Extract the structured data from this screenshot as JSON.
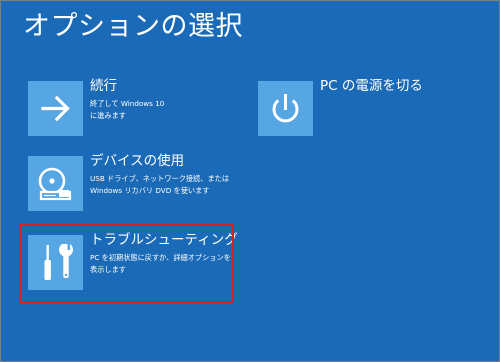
{
  "title": "オプションの選択",
  "options": {
    "continue": {
      "title": "続行",
      "description": "終了して Windows 10\nに進みます",
      "icon": "arrow-right-icon"
    },
    "device": {
      "title": "デバイスの使用",
      "description": "USB ドライブ、ネットワーク接続、または\nWindows リカバリ DVD を使います",
      "icon": "disc-drive-icon"
    },
    "troubleshoot": {
      "title": "トラブルシューティング",
      "description": "PC を初期状態に戻すか、詳細オプションを\n表示します",
      "icon": "tools-icon"
    },
    "power": {
      "title": "PC の電源を切る",
      "description": "",
      "icon": "power-icon"
    }
  },
  "colors": {
    "background": "#1b6ab7",
    "tile_icon_bg": "#56a6e4",
    "highlight_border": "#d51f2a",
    "text": "#ffffff"
  }
}
